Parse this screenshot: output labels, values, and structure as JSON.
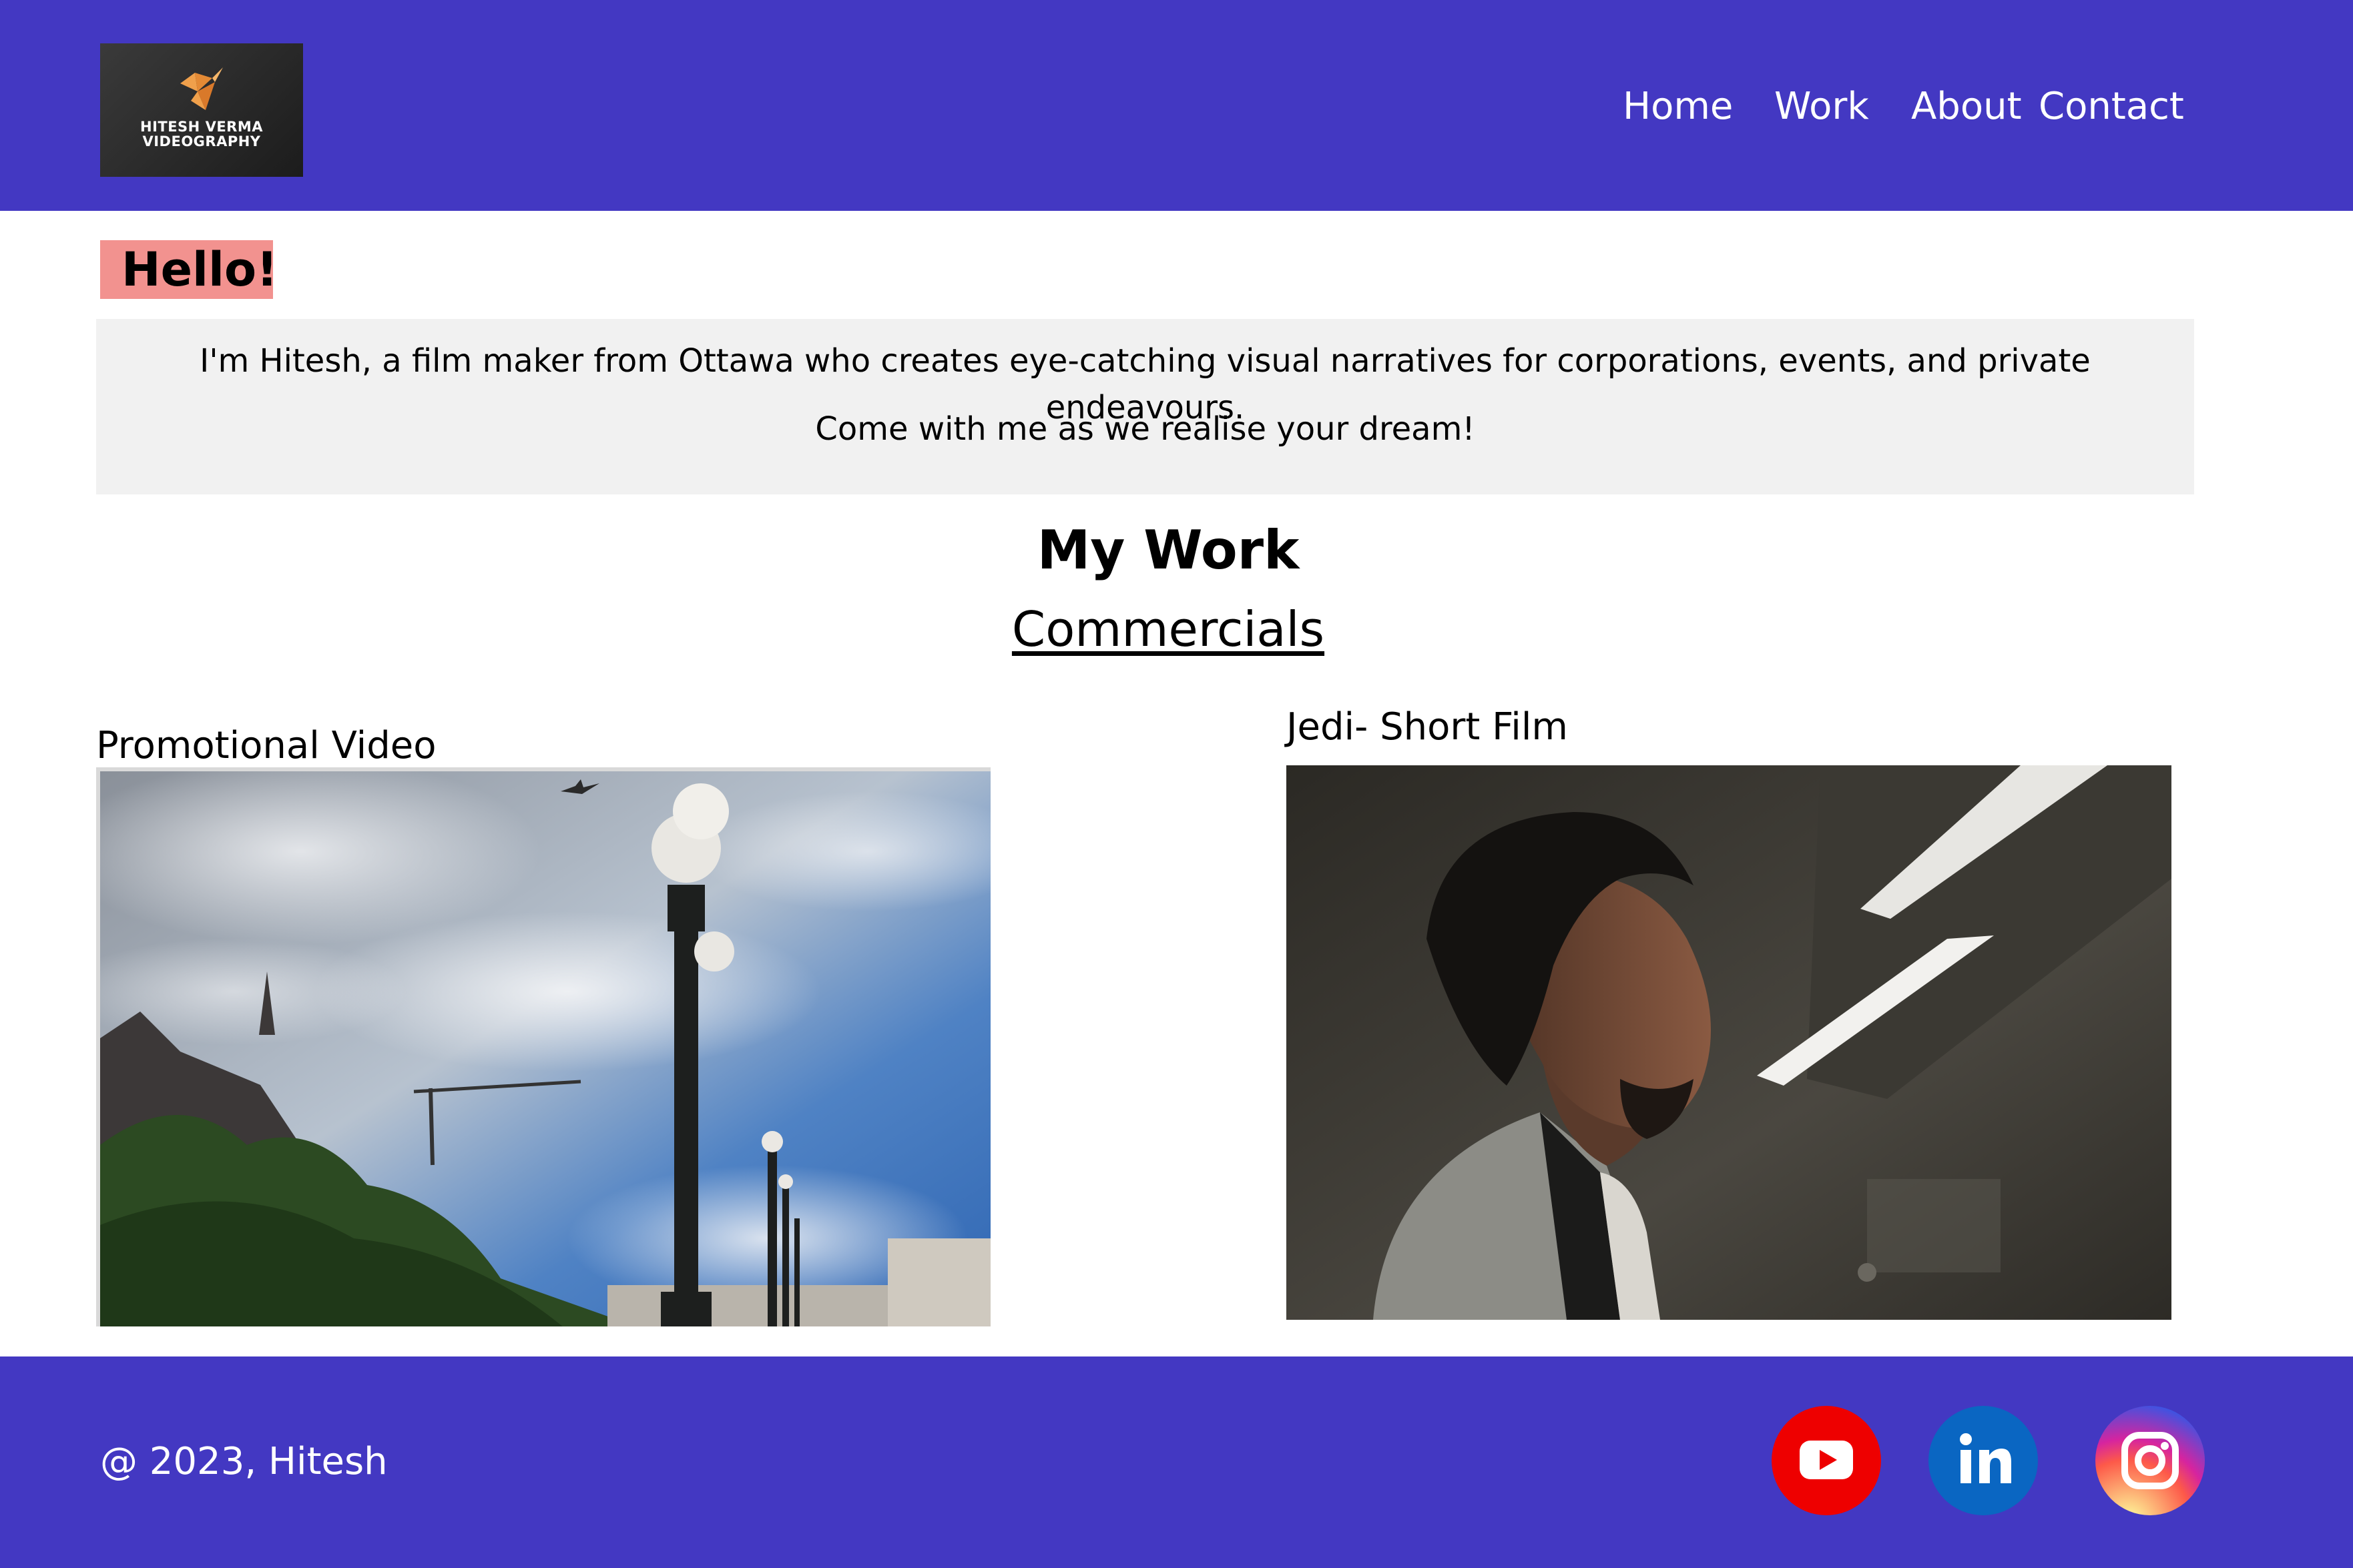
{
  "header": {
    "logo": {
      "line1": "HITESH VERMA",
      "line2": "VIDEOGRAPHY",
      "icon": "origami-bird-icon",
      "icon_color": "#f0a04b"
    },
    "nav": [
      "Home",
      "Work",
      "About",
      "Contact"
    ],
    "background_color": "#4338c2"
  },
  "hello": {
    "label": "Hello!",
    "background_color": "#f2928f"
  },
  "intro": {
    "line1": "I'm Hitesh, a film maker from Ottawa who creates eye-catching visual narratives for corporations, events, and private endeavours.",
    "line2": "Come with me as we realise your dream!"
  },
  "work": {
    "heading": "My Work",
    "subheading": "Commercials",
    "items": [
      {
        "caption": "Promotional Video",
        "image": "ottawa-lamp-posts-sky-photo"
      },
      {
        "caption": "Jedi- Short Film",
        "image": "man-profile-portrait-photo"
      }
    ]
  },
  "footer": {
    "copyright": "@ 2023, Hitesh",
    "social": [
      {
        "name": "youtube-icon",
        "color": "#ee0000"
      },
      {
        "name": "linkedin-icon",
        "color": "#0a66c2"
      },
      {
        "name": "instagram-icon",
        "color": "#d6249f"
      }
    ]
  }
}
